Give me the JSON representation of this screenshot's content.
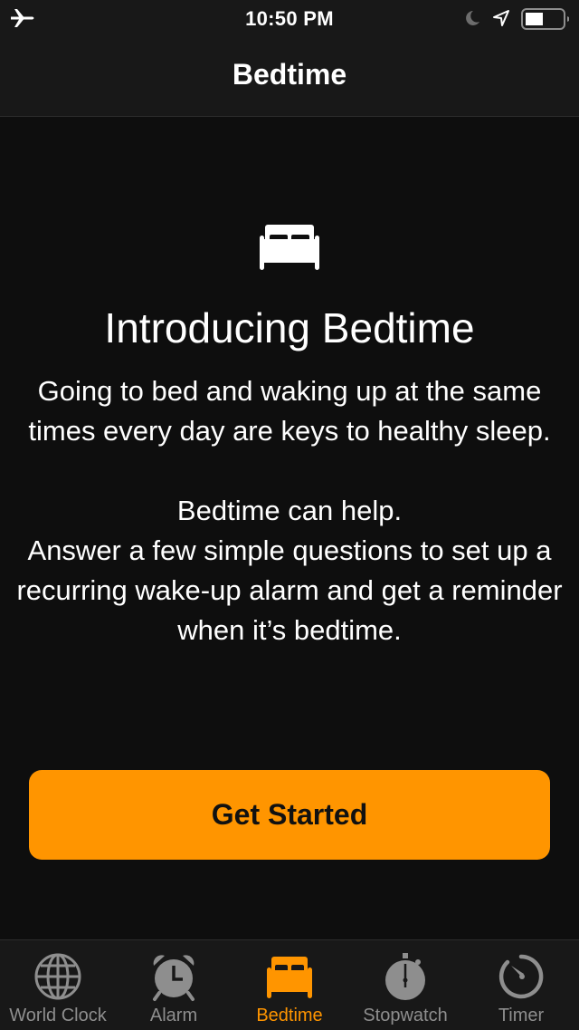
{
  "status_bar": {
    "time": "10:50 PM",
    "icons": [
      "airplane-mode-icon",
      "do-not-disturb-moon-icon",
      "location-arrow-icon",
      "battery-icon"
    ],
    "battery_level_fraction": 0.45
  },
  "nav": {
    "title": "Bedtime"
  },
  "intro": {
    "icon": "bed-icon",
    "title": "Introducing Bedtime",
    "paragraph1": "Going to bed and waking up at the same times every day are keys to healthy sleep.",
    "paragraph2_line1": "Bedtime can help.",
    "paragraph2_line2": "Answer a few simple questions to set up a recurring wake-up alarm and get a reminder when it’s bedtime."
  },
  "cta": {
    "label": "Get Started"
  },
  "tabbar": {
    "active_tab": "Bedtime",
    "items": [
      {
        "label": "World Clock",
        "icon": "globe-icon"
      },
      {
        "label": "Alarm",
        "icon": "alarm-clock-icon"
      },
      {
        "label": "Bedtime",
        "icon": "bed-icon"
      },
      {
        "label": "Stopwatch",
        "icon": "stopwatch-icon"
      },
      {
        "label": "Timer",
        "icon": "timer-icon"
      }
    ]
  },
  "colors": {
    "accent": "#ff9500",
    "background": "#0e0e0e",
    "bars": "#181818",
    "inactive": "#8e8e8e"
  }
}
